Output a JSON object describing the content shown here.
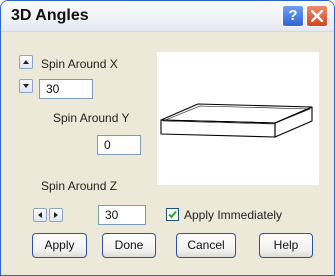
{
  "window": {
    "title": "3D Angles",
    "help_glyph": "?"
  },
  "spin_x": {
    "label": "Spin Around X",
    "value": "30"
  },
  "spin_y": {
    "label": "Spin Around Y",
    "value": "0"
  },
  "spin_z": {
    "label": "Spin Around Z",
    "value": "30"
  },
  "apply_immediately": {
    "label": "Apply Immediately",
    "checked": true
  },
  "buttons": {
    "apply": "Apply",
    "done": "Done",
    "cancel": "Cancel",
    "help": "Help"
  },
  "colors": {
    "title_border": "#2c63c8",
    "dialog_bg": "#ece9d8",
    "check_mark": "#2aa52a",
    "close_button": "#d3451f",
    "help_button": "#2d65d8"
  }
}
